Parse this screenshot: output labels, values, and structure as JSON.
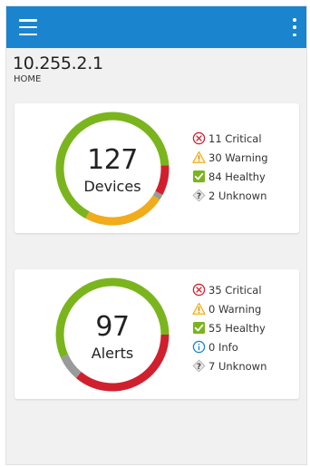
{
  "colors": {
    "appbar": "#1a84cf",
    "critical": "#d0202e",
    "warning": "#f0ac1a",
    "healthy": "#7ab51d",
    "unknown": "#9a9a9a",
    "info": "#1a84cf"
  },
  "appbar": {
    "menu_icon": "hamburger-menu-icon",
    "more_icon": "more-vertical-icon"
  },
  "host": {
    "ip": "10.255.2.1",
    "label": "HOME"
  },
  "devices": {
    "total": "127",
    "label": "Devices",
    "legend": [
      {
        "icon": "critical-icon",
        "text": "11 Critical"
      },
      {
        "icon": "warning-icon",
        "text": "30 Warning"
      },
      {
        "icon": "healthy-icon",
        "text": "84 Healthy"
      },
      {
        "icon": "unknown-icon",
        "text": "2 Unknown"
      }
    ]
  },
  "alerts": {
    "total": "97",
    "label": "Alerts",
    "legend": [
      {
        "icon": "critical-icon",
        "text": "35 Critical"
      },
      {
        "icon": "warning-icon",
        "text": "0 Warning"
      },
      {
        "icon": "healthy-icon",
        "text": "55 Healthy"
      },
      {
        "icon": "info-icon",
        "text": "0 Info"
      },
      {
        "icon": "unknown-icon",
        "text": "7 Unknown"
      }
    ]
  },
  "chart_data": [
    {
      "type": "pie",
      "title": "Devices",
      "categories": [
        "Critical",
        "Warning",
        "Healthy",
        "Unknown"
      ],
      "values": [
        11,
        30,
        84,
        2
      ]
    },
    {
      "type": "pie",
      "title": "Alerts",
      "categories": [
        "Critical",
        "Warning",
        "Healthy",
        "Info",
        "Unknown"
      ],
      "values": [
        35,
        0,
        55,
        0,
        7
      ]
    }
  ]
}
